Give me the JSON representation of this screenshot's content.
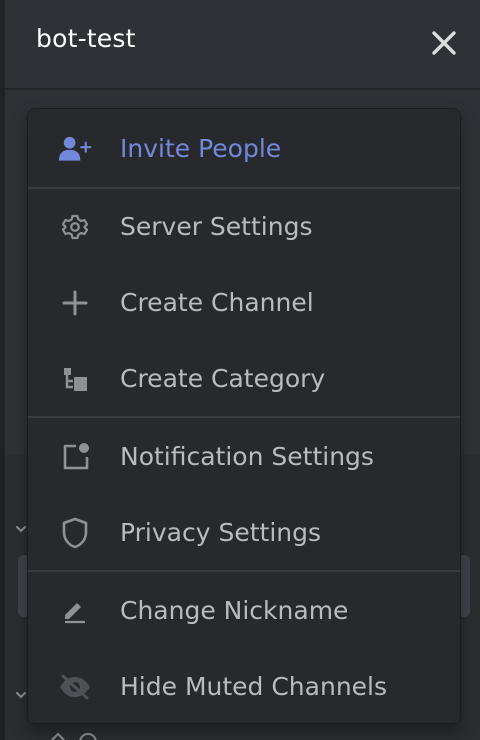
{
  "header": {
    "title": "bot-test",
    "close_icon": "close-icon"
  },
  "colors": {
    "accent": "#7289da",
    "text_muted": "#b9bbbe",
    "background": "#2f3136",
    "menu_background": "#28292d"
  },
  "menu": {
    "items": [
      {
        "label": "Invite People",
        "icon": "invite-people-icon"
      },
      {
        "label": "Server Settings",
        "icon": "gear-icon"
      },
      {
        "label": "Create Channel",
        "icon": "plus-icon"
      },
      {
        "label": "Create Category",
        "icon": "category-icon"
      },
      {
        "label": "Notification Settings",
        "icon": "notification-icon"
      },
      {
        "label": "Privacy Settings",
        "icon": "shield-icon"
      },
      {
        "label": "Change Nickname",
        "icon": "pencil-icon"
      },
      {
        "label": "Hide Muted Channels",
        "icon": "eye-off-icon"
      }
    ]
  }
}
